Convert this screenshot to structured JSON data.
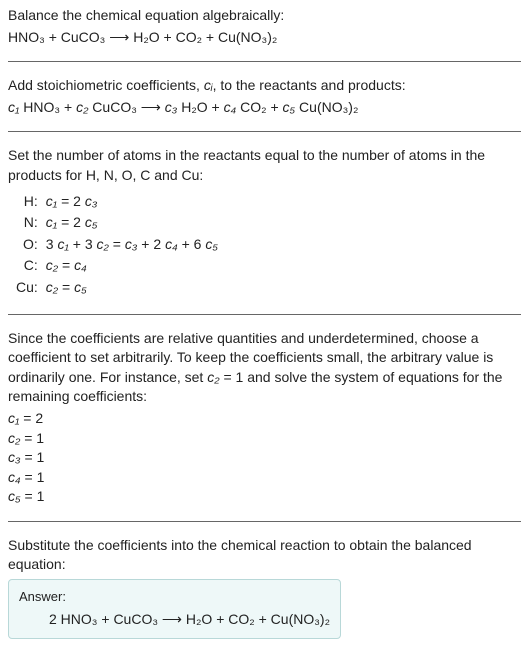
{
  "section1": {
    "intro": "Balance the chemical equation algebraically:",
    "equation": "HNO₃ + CuCO₃  ⟶  H₂O + CO₂ + Cu(NO₃)₂"
  },
  "section2": {
    "intro_a": "Add stoichiometric coefficients, ",
    "intro_var": "cᵢ",
    "intro_b": ", to the reactants and products:",
    "equation_a": "c₁",
    "equation_b": " HNO₃ + ",
    "equation_c": "c₂",
    "equation_d": " CuCO₃  ⟶  ",
    "equation_e": "c₃",
    "equation_f": " H₂O + ",
    "equation_g": "c₄",
    "equation_h": " CO₂ + ",
    "equation_i": "c₅",
    "equation_j": " Cu(NO₃)₂"
  },
  "section3": {
    "intro": "Set the number of atoms in the reactants equal to the number of atoms in the products for H, N, O, C and Cu:",
    "rows": [
      {
        "el": "H:",
        "exp_a": "c₁",
        "exp_b": " = 2 ",
        "exp_c": "c₃"
      },
      {
        "el": "N:",
        "exp_a": "c₁",
        "exp_b": " = 2 ",
        "exp_c": "c₅"
      },
      {
        "el": "O:",
        "exp_a": "3 ",
        "exp_b": "c₁",
        "exp_c": " + 3 ",
        "exp_d": "c₂",
        "exp_e": " = ",
        "exp_f": "c₃",
        "exp_g": " + 2 ",
        "exp_h": "c₄",
        "exp_i": " + 6 ",
        "exp_j": "c₅"
      },
      {
        "el": "C:",
        "exp_a": "c₂",
        "exp_b": " = ",
        "exp_c": "c₄"
      },
      {
        "el": "Cu:",
        "exp_a": "c₂",
        "exp_b": " = ",
        "exp_c": "c₅"
      }
    ]
  },
  "section4": {
    "intro_a": "Since the coefficients are relative quantities and underdetermined, choose a coefficient to set arbitrarily. To keep the coefficients small, the arbitrary value is ordinarily one. For instance, set ",
    "intro_var": "c₂",
    "intro_b": " = 1 and solve the system of equations for the remaining coefficients:",
    "coeffs": [
      {
        "v": "c₁",
        "t": " = 2"
      },
      {
        "v": "c₂",
        "t": " = 1"
      },
      {
        "v": "c₃",
        "t": " = 1"
      },
      {
        "v": "c₄",
        "t": " = 1"
      },
      {
        "v": "c₅",
        "t": " = 1"
      }
    ]
  },
  "section5": {
    "intro": "Substitute the coefficients into the chemical reaction to obtain the balanced equation:",
    "answer_label": "Answer:",
    "answer_eq": "2 HNO₃ + CuCO₃  ⟶  H₂O + CO₂ + Cu(NO₃)₂"
  }
}
